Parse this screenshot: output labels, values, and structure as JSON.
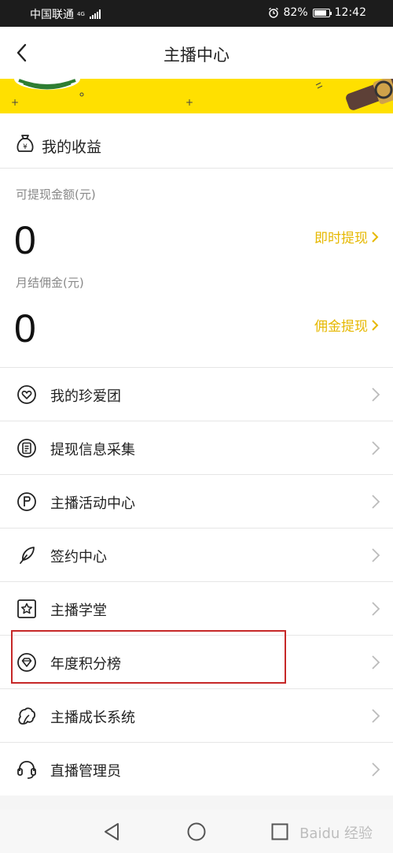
{
  "status_bar": {
    "carrier": "中国联通",
    "network": "4G",
    "battery": "82%",
    "time": "12:42"
  },
  "nav": {
    "title": "主播中心"
  },
  "earnings": {
    "title": "我的收益",
    "withdrawable_label": "可提现金额(元)",
    "withdrawable_value": "0",
    "withdraw_link": "即时提现",
    "commission_label": "月结佣金(元)",
    "commission_value": "0",
    "commission_link": "佣金提现"
  },
  "menu": {
    "items": [
      {
        "label": "我的珍爱团",
        "icon": "heart-circle-icon"
      },
      {
        "label": "提现信息采集",
        "icon": "document-icon"
      },
      {
        "label": "主播活动中心",
        "icon": "flag-circle-icon"
      },
      {
        "label": "签约中心",
        "icon": "feather-icon"
      },
      {
        "label": "主播学堂",
        "icon": "star-square-icon"
      },
      {
        "label": "年度积分榜",
        "icon": "diamond-circle-icon"
      },
      {
        "label": "主播成长系统",
        "icon": "growth-icon"
      },
      {
        "label": "直播管理员",
        "icon": "headset-icon"
      }
    ],
    "highlighted_index": 5
  },
  "watermark": "Baidu 经验",
  "colors": {
    "accent": "#e6b800",
    "banner": "#ffe000",
    "highlight": "#c62828"
  }
}
